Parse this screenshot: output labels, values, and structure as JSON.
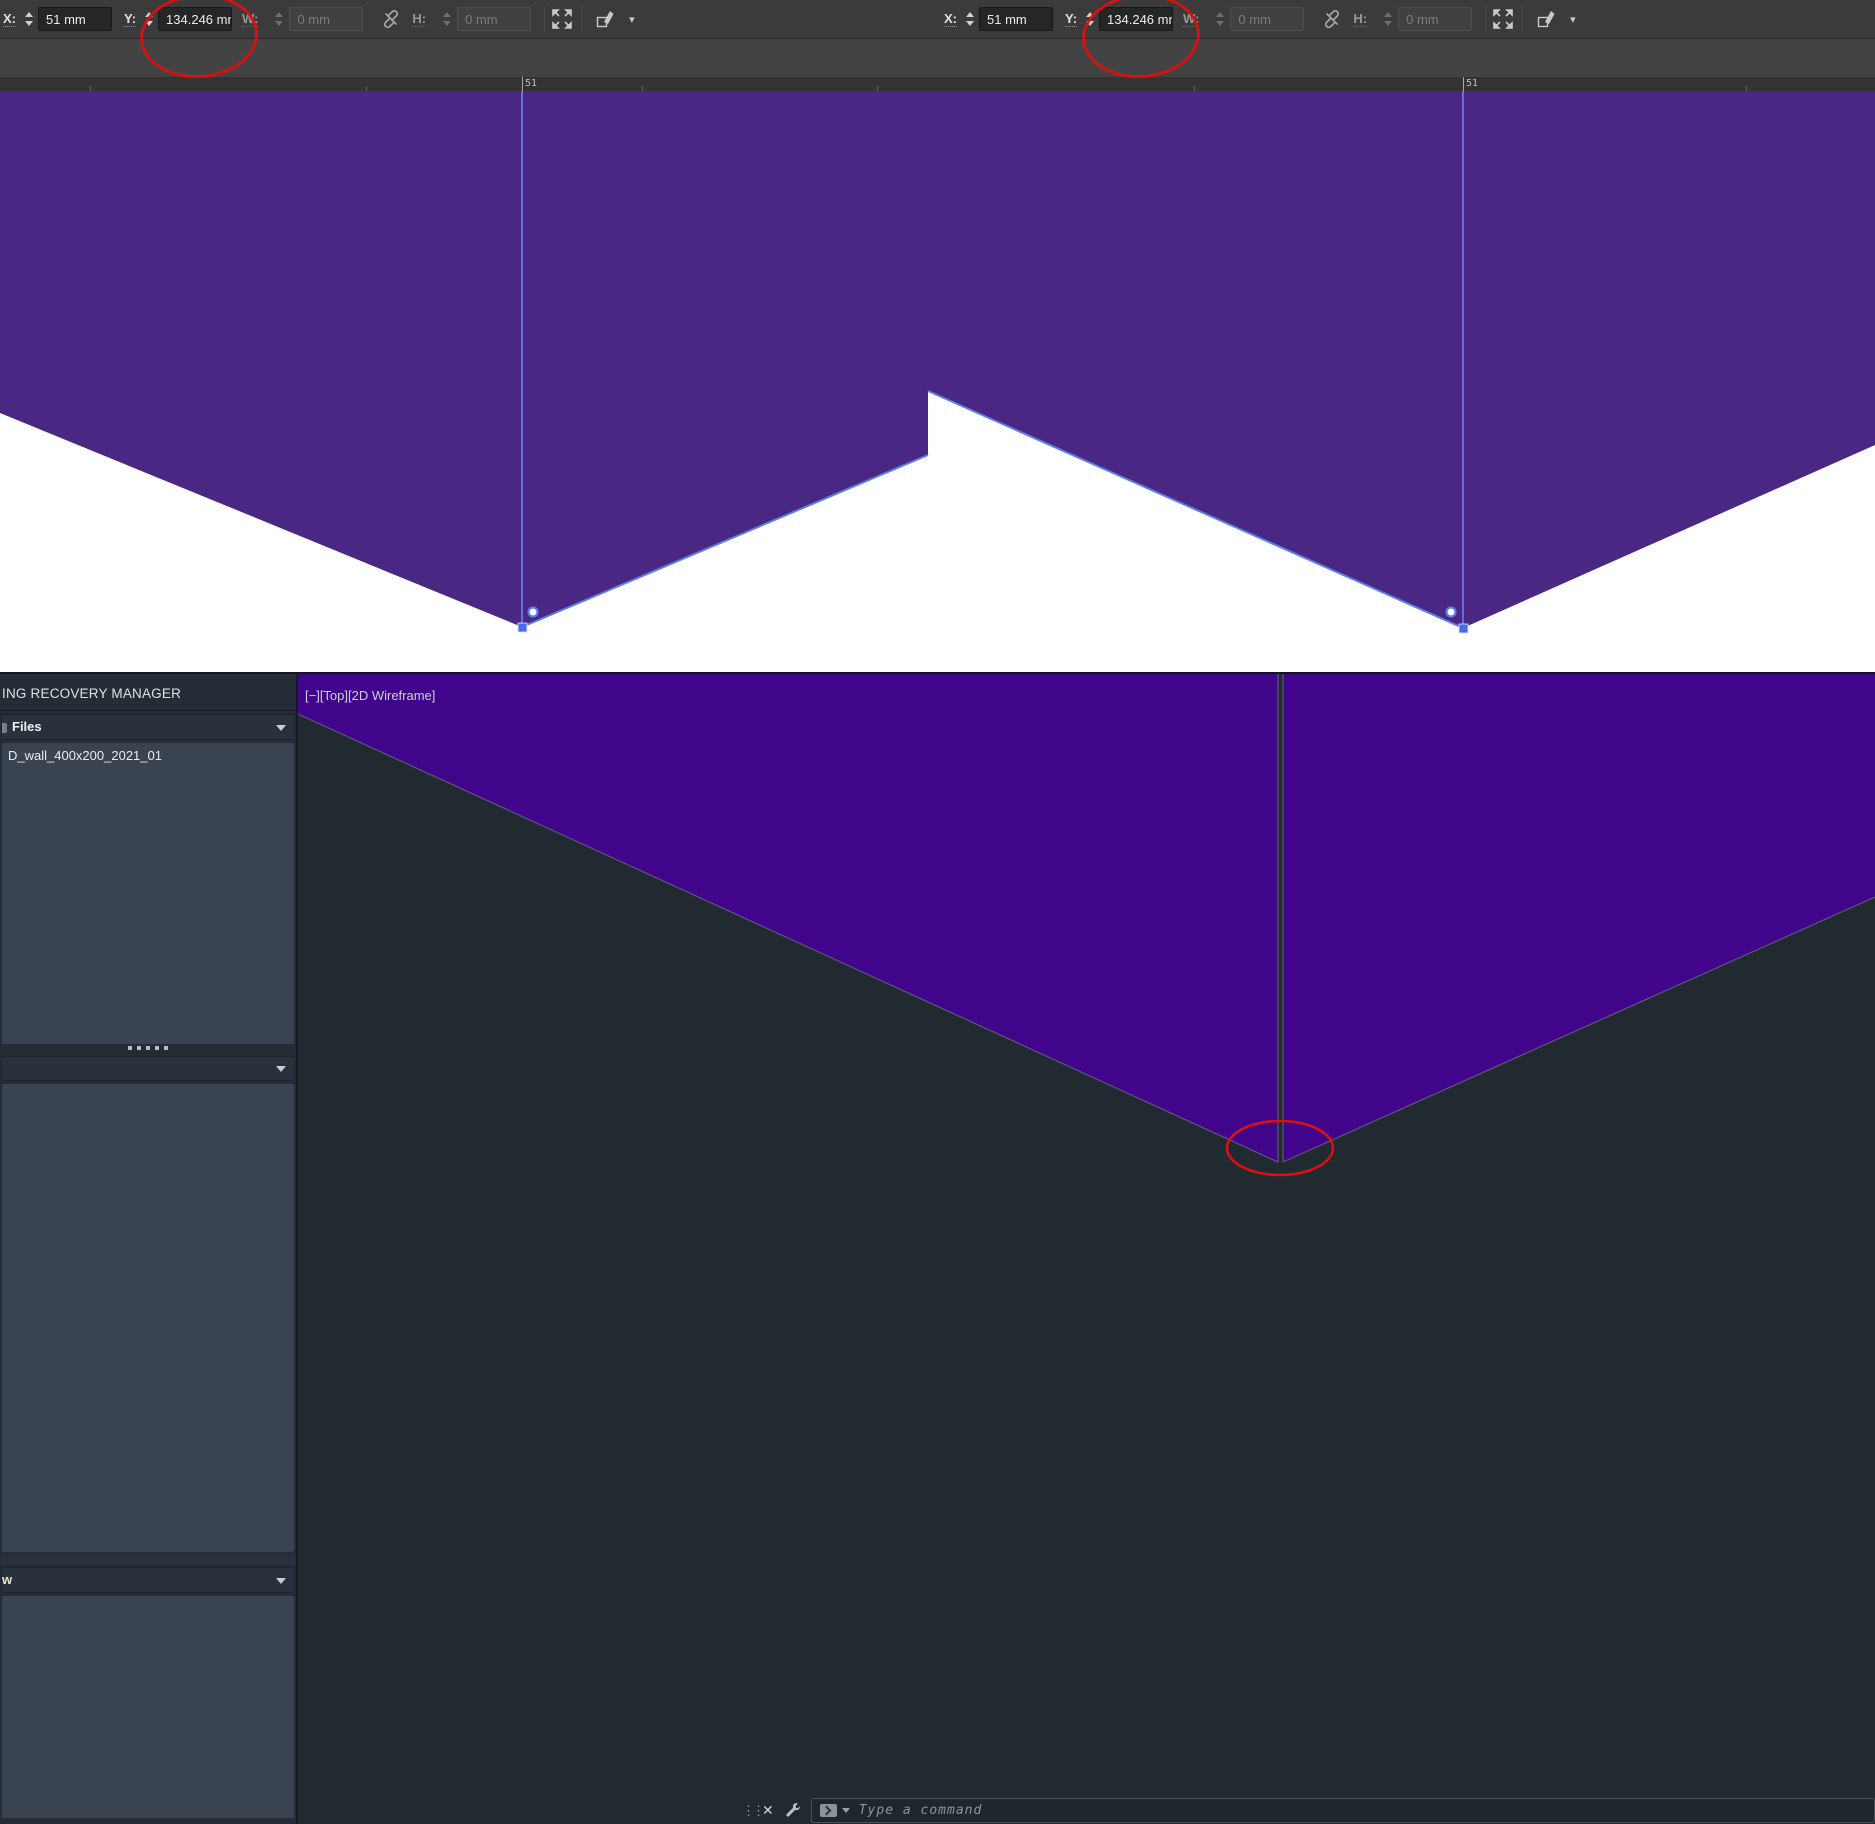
{
  "illustrator": {
    "toolbar": {
      "x_label": "X:",
      "x_value": "51 mm",
      "y_label": "Y:",
      "y_value": "134.246 mr",
      "w_label": "W:",
      "w_value": "0 mm",
      "h_label": "H:",
      "h_value": "0 mm"
    },
    "ruler": {
      "marker_label": "51"
    }
  },
  "autocad": {
    "panel": {
      "title": "ING RECOVERY MANAGER",
      "files_header": "Files",
      "file_item": "D_wall_400x200_2021_01",
      "bottom_header_fragment": "w"
    },
    "viewport": {
      "label": "[−][Top][2D Wireframe]"
    },
    "command_bar": {
      "placeholder": "Type a command"
    }
  },
  "colors": {
    "artboard_purple": "#4a2782",
    "selection_blue": "#5c7cea",
    "guide_blue": "#6e87f5",
    "viewport_purple": "#41058c",
    "annotation_red": "#d81111",
    "viewport_background": "#212931",
    "toolbar_background": "#3b3b3b",
    "panel_background": "#242c35"
  }
}
